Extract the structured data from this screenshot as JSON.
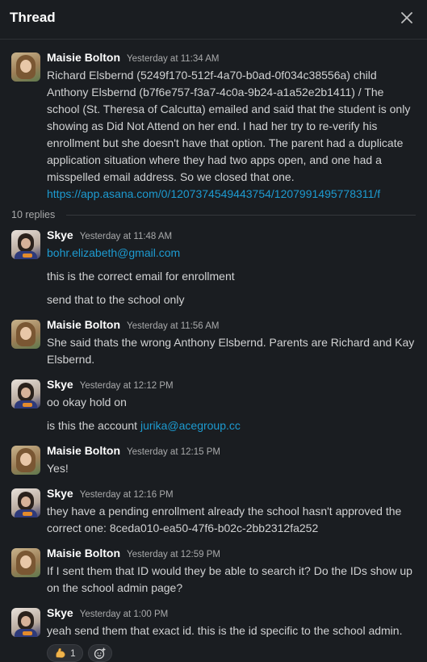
{
  "header": {
    "title": "Thread"
  },
  "colors": {
    "background": "#1a1d21",
    "link": "#1d9bd1",
    "text": "#d1d2d3"
  },
  "icons": {
    "close": "close-icon",
    "add_reaction": "add-reaction-icon",
    "reaction_emoji": "flexed-biceps"
  },
  "parent": {
    "author": "Maisie Bolton",
    "time": "Yesterday at 11:34 AM",
    "text": "Richard Elsbernd (5249f170-512f-4a70-b0ad-0f034c38556a) child Anthony Elsbernd (b7f6e757-f3a7-4c0a-9b24-a1a52e2b1411) / The school (St. Theresa of Calcutta) emailed and said that the student is only showing as Did Not Attend on her end. I had her try to re-verify his enrollment but she doesn't have that option. The parent had a duplicate application situation where they had two apps open, and one had a misspelled email address. So we closed that one.",
    "link": "https://app.asana.com/0/1207374549443754/1207991495778311/f"
  },
  "replies_label": "10 replies",
  "replies": [
    {
      "author": "Skye",
      "time": "Yesterday at 11:48 AM",
      "link": "bohr.elizabeth@gmail.com",
      "lines": [
        "this is the correct email for enrollment",
        "send that to the school only"
      ]
    },
    {
      "author": "Maisie Bolton",
      "time": "Yesterday at 11:56 AM",
      "text": "She said thats the wrong Anthony Elsbernd. Parents are Richard and Kay Elsbernd."
    },
    {
      "author": "Skye",
      "time": "Yesterday at 12:12 PM",
      "text": "oo okay hold on",
      "cont_prefix": "is this the account ",
      "cont_link": "jurika@acegroup.cc"
    },
    {
      "author": "Maisie Bolton",
      "time": "Yesterday at 12:15 PM",
      "text": "Yes!"
    },
    {
      "author": "Skye",
      "time": "Yesterday at 12:16 PM",
      "text": "they have a pending enrollment already the school hasn't approved the correct one: 8ceda010-ea50-47f6-b02c-2bb2312fa252"
    },
    {
      "author": "Maisie Bolton",
      "time": "Yesterday at 12:59 PM",
      "text": "If I sent them that ID would they be able to search it? Do the IDs show up on the school admin page?"
    },
    {
      "author": "Skye",
      "time": "Yesterday at 1:00 PM",
      "text": "yeah send them that exact id. this is the id specific to the school admin.",
      "reaction_count": "1"
    }
  ]
}
